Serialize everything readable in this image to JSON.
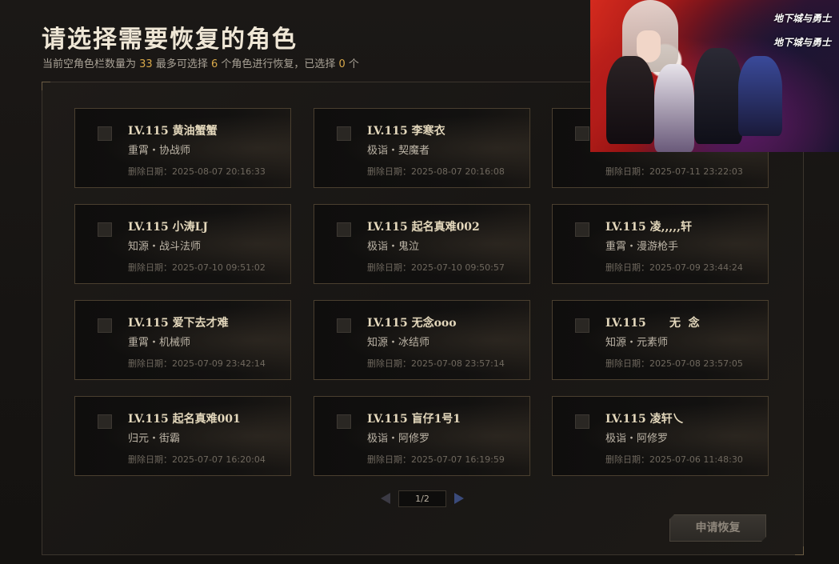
{
  "header": {
    "title": "请选择需要恢复的角色",
    "subtitle_parts": {
      "pre": "当前空角色栏数量为 ",
      "empty_slots": "33",
      "mid": " 最多可选择 ",
      "max_select": "6",
      "mid2": " 个角色进行恢复，已选择 ",
      "selected": "0",
      "post": " 个"
    }
  },
  "characters": [
    {
      "name": "LV.115 黄油蟹蟹",
      "class": "重霄・协战师",
      "date": "删除日期：2025-08-07 20:16:33"
    },
    {
      "name": "LV.115 李寒衣",
      "class": "极诣・契魔者",
      "date": "删除日期：2025-08-07 20:16:08"
    },
    {
      "name": "",
      "class": "",
      "date": "删除日期：2025-07-11 23:22:03"
    },
    {
      "name": "LV.115 小涛LJ",
      "class": "知源・战斗法师",
      "date": "删除日期：2025-07-10 09:51:02"
    },
    {
      "name": "LV.115 起名真难002",
      "class": "极诣・鬼泣",
      "date": "删除日期：2025-07-10 09:50:57"
    },
    {
      "name": "LV.115 凌,,,,,轩",
      "class": "重霄・漫游枪手",
      "date": "删除日期：2025-07-09 23:44:24"
    },
    {
      "name": "LV.115 爱下去才难",
      "class": "重霄・机械师",
      "date": "删除日期：2025-07-09 23:42:14"
    },
    {
      "name": "LV.115 无念ooo",
      "class": "知源・冰结师",
      "date": "删除日期：2025-07-08 23:57:14"
    },
    {
      "name": "LV.115      无  念",
      "class": "知源・元素师",
      "date": "删除日期：2025-07-08 23:57:05"
    },
    {
      "name": "LV.115 起名真难001",
      "class": "归元・街霸",
      "date": "删除日期：2025-07-07 16:20:04"
    },
    {
      "name": "LV.115 盲仔1号1",
      "class": "极诣・阿修罗",
      "date": "删除日期：2025-07-07 16:19:59"
    },
    {
      "name": "LV.115 凌轩乀",
      "class": "极诣・阿修罗",
      "date": "删除日期：2025-07-06 11:48:30"
    }
  ],
  "pagination": {
    "page_label": "1/2",
    "prev_icon": "arrow-left-icon",
    "next_icon": "arrow-right-icon"
  },
  "actions": {
    "apply_label": "申请恢复"
  },
  "banner": {
    "logo_text_1": "地下城与勇士",
    "logo_text_2": "地下城与勇士"
  },
  "colors": {
    "accent_number": "#d9a94a",
    "card_border": "#4a3f2f",
    "title": "#efe7d6"
  }
}
